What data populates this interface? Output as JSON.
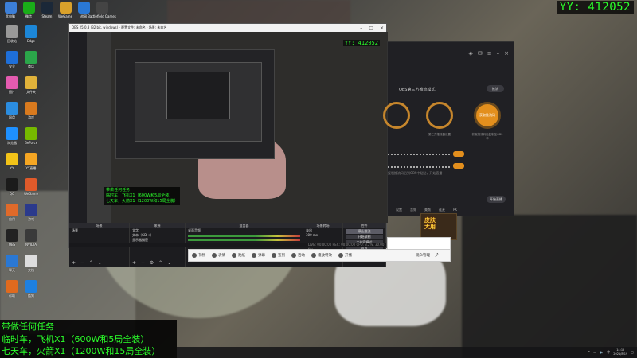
{
  "overlay": {
    "yy_id": "YY: 412052",
    "task_lines": [
      "带做任何任务",
      "临时车，飞机X1（600W和5局全装）",
      "七天车，火箭X1（1200W和15局全装）"
    ]
  },
  "desktop_top_icons": [
    {
      "icon": "network-icon",
      "label": "此电脑",
      "color": "#3c7fd8"
    },
    {
      "icon": "wechat-icon",
      "label": "微信",
      "color": "#1aad19"
    },
    {
      "icon": "steam-icon",
      "label": "Steam",
      "color": "#1b2838"
    },
    {
      "icon": "wegame-icon",
      "label": "WeGame",
      "color": "#d9a12b"
    },
    {
      "icon": "battlenet-icon",
      "label": "战网",
      "color": "#2a78d4"
    },
    {
      "icon": "game-icon",
      "label": "Battlefield Games",
      "color": "#444"
    }
  ],
  "desktop_left_icons": [
    {
      "icon": "recycle-bin-icon",
      "label": "回收站",
      "color": "#999"
    },
    {
      "icon": "edge-icon",
      "label": "Edge",
      "color": "#1c87d8"
    },
    {
      "icon": "shield-icon",
      "label": "安全",
      "color": "#1e6fd9"
    },
    {
      "icon": "store-icon",
      "label": "商店",
      "color": "#2ba64a"
    },
    {
      "icon": "photos-icon",
      "label": "图片",
      "color": "#e45bb0"
    },
    {
      "icon": "folder-icon",
      "label": "文件夹",
      "color": "#e0b23a"
    },
    {
      "icon": "cloud-icon",
      "label": "网盘",
      "color": "#2b8de0"
    },
    {
      "icon": "game-app-icon",
      "label": "游戏",
      "color": "#d97a1e"
    },
    {
      "icon": "ie-icon",
      "label": "浏览器",
      "color": "#1e90ff"
    },
    {
      "icon": "nvidia-icon",
      "label": "GeForce",
      "color": "#76b900"
    },
    {
      "icon": "yy-app-icon",
      "label": "YY",
      "color": "#f2c318"
    },
    {
      "icon": "yy-live-icon",
      "label": "YY直播",
      "color": "#f5a623"
    },
    {
      "icon": "qq-icon",
      "label": "QQ",
      "color": "#1b1b1b"
    },
    {
      "icon": "wegame-app-icon",
      "label": "WeGame",
      "color": "#e05a2a"
    },
    {
      "icon": "app-icon",
      "label": "应用",
      "color": "#e06a2a"
    },
    {
      "icon": "game-launcher-icon",
      "label": "游戏",
      "color": "#2b3a8c"
    },
    {
      "icon": "obs-icon",
      "label": "OBS",
      "color": "#222"
    },
    {
      "icon": "nvidia-exp-icon",
      "label": "NVIDIA",
      "color": "#3a3a3a"
    },
    {
      "icon": "chat-icon",
      "label": "聊天",
      "color": "#2a78d4"
    },
    {
      "icon": "document-icon",
      "label": "文档",
      "color": "#ddd"
    },
    {
      "icon": "help-icon",
      "label": "帮助",
      "color": "#e06a1e"
    },
    {
      "icon": "kugou-icon",
      "label": "酷狗",
      "color": "#1e80e0"
    }
  ],
  "obs": {
    "title": "OBS 25.0.8 (32 bit, windows) - 配置文件: 未命名 - 场景: 未命名",
    "menu": [
      "文件(F)",
      "编辑(E)",
      "视图(V)",
      "停靠部件(D)",
      "配置文件(P)",
      "场景集合(S)",
      "工具(T)",
      "帮助(H)"
    ],
    "preview_yy": "YY: 412052",
    "preview_task": [
      "带做任何任务",
      "临时车，飞机X1（600W和5局全装）",
      "七天车，火箭X1（1200W和15局全装）"
    ],
    "docks": {
      "scenes_title": "场景",
      "scenes": [
        "场景"
      ],
      "sources_title": "来源",
      "sources": [
        "文字",
        "文本（GDI+）",
        "显示器捕获"
      ],
      "mixer_title": "混音器",
      "mixer": [
        "桌面音频",
        "麦克风/Aux"
      ],
      "transitions_title": "场景转场",
      "transition_value": "淡出",
      "duration_value": "300 ms",
      "controls_title": "控件",
      "controls": [
        "停止推流",
        "开始录制",
        "工作室模式",
        "设置",
        "退出"
      ]
    },
    "status": "LIVE: 00:00:00  REC: 00:00:00  CPU: 3.2%, 30.00 fps"
  },
  "yy_panel": {
    "mode_text": "OBS第三方推流模式",
    "mode_button": "推流",
    "circles": [
      {
        "label": "",
        "caption": ""
      },
      {
        "label": "",
        "caption": "第三方推流器设置"
      },
      {
        "label": "获取推流码",
        "caption": "获取推流码后复制至OBS中"
      }
    ],
    "note": "复制推流码后到OBS中粘贴，开始直播",
    "start_button": "开始直播",
    "bottom_items": [
      "设置",
      "音效",
      "美颜",
      "连麦",
      "PK"
    ]
  },
  "mini_live": {
    "banner": "皮肤\n大用"
  },
  "toolbar": {
    "items": [
      "礼物",
      "表情",
      "贴纸",
      "弹幕",
      "签到",
      "活动",
      "抽奖",
      "投票",
      "播放特效",
      "开播"
    ],
    "right": [
      "观众管理",
      "分享",
      "更多"
    ]
  },
  "taskbar": {
    "time": "14:15",
    "date": "2021/8/19",
    "lang": "中",
    "volume_label": "49%"
  }
}
